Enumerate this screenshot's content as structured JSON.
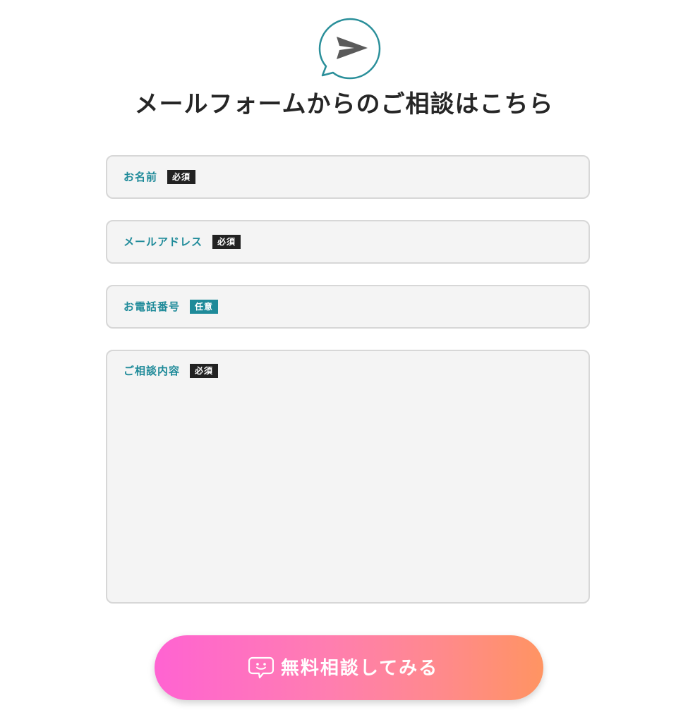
{
  "header": {
    "icon": "send-message-icon",
    "title": "メールフォームからのご相談はこちら"
  },
  "form": {
    "fields": [
      {
        "label": "お名前",
        "badge": "必須",
        "badge_type": "required",
        "value": ""
      },
      {
        "label": "メールアドレス",
        "badge": "必須",
        "badge_type": "required",
        "value": ""
      },
      {
        "label": "お電話番号",
        "badge": "任意",
        "badge_type": "optional",
        "value": ""
      },
      {
        "label": "ご相談内容",
        "badge": "必須",
        "badge_type": "required",
        "value": ""
      }
    ],
    "submit": {
      "icon": "smiley-chat-bubble-icon",
      "label": "無料相談してみる"
    }
  },
  "colors": {
    "accent": "#1e8a99",
    "required_badge": "#222222",
    "optional_badge": "#1e8a99",
    "field_bg": "#f4f4f4",
    "field_border": "#d7d7d7",
    "title_text": "#262626",
    "button_gradient_start": "#ff63d2",
    "button_gradient_end": "#ff9462"
  }
}
